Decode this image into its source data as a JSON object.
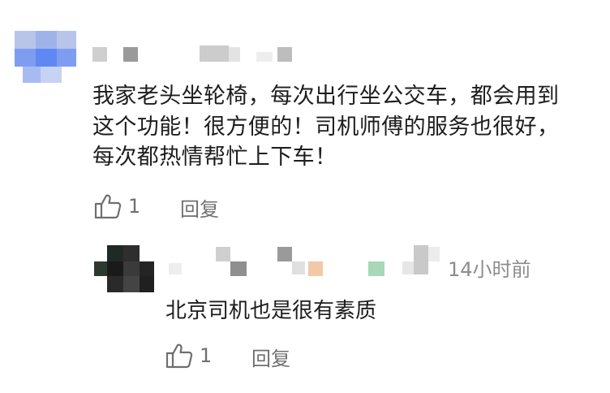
{
  "comment": {
    "text": "我家老头坐轮椅，每次出行坐公交车，都会用到这个功能！很方便的！司机师傅的服务也很好，每次都热情帮忙上下车！",
    "likes": "1",
    "reply_label": "回复"
  },
  "reply": {
    "text": "北京司机也是很有素质",
    "timestamp": "14小时前",
    "likes": "1",
    "reply_label": "回复"
  },
  "icons": [
    "thumbs-up-icon"
  ],
  "colors": {
    "text": "#1d1d1d",
    "secondary": "#6f6f6f",
    "timestamp": "#8c8c8c"
  }
}
